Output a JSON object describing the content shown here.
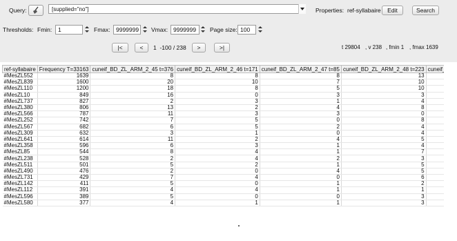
{
  "query": {
    "label": "Query:",
    "value": "[supplied=\"no\"]"
  },
  "properties": {
    "label": "Properties:",
    "value": "ref-syllabaire",
    "edit_label": "Edit",
    "search_label": "Search"
  },
  "thresholds": {
    "label": "Thresholds:",
    "fmin_label": "Fmin:",
    "fmin_value": "1",
    "fmax_label": "Fmax:",
    "fmax_value": "9999999",
    "vmax_label": "Vmax:",
    "vmax_value": "9999999",
    "page_size_label": "Page size:",
    "page_size_value": "100"
  },
  "nav": {
    "first_label": "|<",
    "prev_label": "<",
    "page_info": "1  -100 / 238",
    "next_label": ">",
    "last_label": ">|"
  },
  "stats": {
    "t": "t 29804",
    "v": ", v 238",
    "fmin": ", fmin 1",
    "fmax": ", fmax 1639"
  },
  "table": {
    "headers": [
      "ref-syllabaire",
      "Frequency T=33163",
      "cuneif_BD_ZL_ARM_2_45 t=376",
      "cuneif_BD_ZL_ARM_2_46 t=171",
      "cuneif_BD_ZL_ARM_2_47 t=85",
      "cuneif_BD_ZL_ARM_2_48 t=223",
      "cuneif_BD_ZL_ARM_2_"
    ],
    "rows": [
      [
        "#MesZL552",
        "1639",
        "8",
        "8",
        "8",
        "13",
        ""
      ],
      [
        "#MesZL839",
        "1600",
        "20",
        "10",
        "7",
        "10",
        ""
      ],
      [
        "#MesZL110",
        "1200",
        "18",
        "8",
        "5",
        "10",
        ""
      ],
      [
        "#MesZL10",
        "849",
        "16",
        "0",
        "3",
        "3",
        ""
      ],
      [
        "#MesZL737",
        "827",
        "2",
        "3",
        "1",
        "4",
        ""
      ],
      [
        "#MesZL380",
        "806",
        "13",
        "2",
        "4",
        "8",
        ""
      ],
      [
        "#MesZL566",
        "787",
        "11",
        "3",
        "3",
        "0",
        ""
      ],
      [
        "#MesZL252",
        "742",
        "7",
        "5",
        "0",
        "8",
        ""
      ],
      [
        "#MesZL567",
        "682",
        "6",
        "5",
        "2",
        "4",
        ""
      ],
      [
        "#MesZL309",
        "632",
        "3",
        "1",
        "0",
        "4",
        ""
      ],
      [
        "#MesZL641",
        "614",
        "11",
        "2",
        "4",
        "5",
        ""
      ],
      [
        "#MesZL358",
        "596",
        "6",
        "3",
        "1",
        "4",
        ""
      ],
      [
        "#MesZL85",
        "544",
        "8",
        "4",
        "1",
        "7",
        ""
      ],
      [
        "#MesZL238",
        "528",
        "2",
        "4",
        "2",
        "3",
        ""
      ],
      [
        "#MesZL511",
        "501",
        "5",
        "2",
        "1",
        "5",
        ""
      ],
      [
        "#MesZL490",
        "476",
        "2",
        "0",
        "4",
        "5",
        ""
      ],
      [
        "#MesZL731",
        "429",
        "7",
        "4",
        "0",
        "6",
        ""
      ],
      [
        "#MesZL142",
        "411",
        "5",
        "0",
        "1",
        "2",
        ""
      ],
      [
        "#MesZL112",
        "391",
        "4",
        "4",
        "1",
        "1",
        ""
      ],
      [
        "#MesZL596",
        "389",
        "5",
        "0",
        "0",
        "3",
        ""
      ],
      [
        "#MesZL580",
        "377",
        "4",
        "1",
        "1",
        "3",
        ""
      ]
    ]
  },
  "icons": {
    "query_tool": "broom-icon"
  }
}
